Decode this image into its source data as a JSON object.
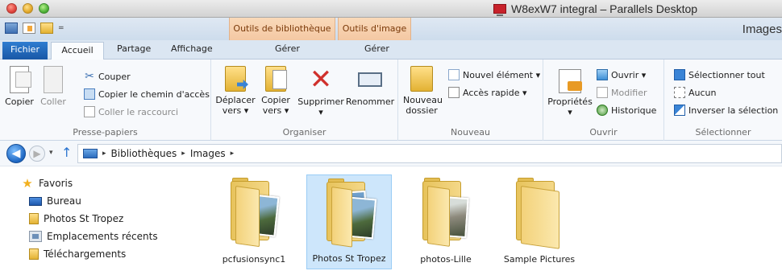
{
  "mac_window": {
    "title": "W8exW7 integral – Parallels Desktop"
  },
  "explorer_title": {
    "contextual_tabs": [
      "Outils de bibliothèque",
      "Outils d'image"
    ],
    "window_title": "Images"
  },
  "ribbon_tabs": {
    "file": "Fichier",
    "home": "Accueil",
    "share": "Partage",
    "view": "Affichage",
    "manage_library": "Gérer",
    "manage_image": "Gérer"
  },
  "ribbon": {
    "clipboard": {
      "label": "Presse-papiers",
      "copy": "Copier",
      "paste": "Coller",
      "cut": "Couper",
      "copy_path": "Copier le chemin d'accès",
      "paste_shortcut": "Coller le raccourci"
    },
    "organize": {
      "label": "Organiser",
      "move_to_1": "Déplacer",
      "move_to_2": "vers ▾",
      "copy_to_1": "Copier",
      "copy_to_2": "vers ▾",
      "delete": "Supprimer",
      "delete_arrow": "▾",
      "rename": "Renommer"
    },
    "new": {
      "label": "Nouveau",
      "new_folder_1": "Nouveau",
      "new_folder_2": "dossier",
      "new_item": "Nouvel élément ▾",
      "easy_access": "Accès rapide ▾"
    },
    "open": {
      "label": "Ouvrir",
      "properties": "Propriétés",
      "properties_arrow": "▾",
      "open": "Ouvrir ▾",
      "edit": "Modifier",
      "history": "Historique"
    },
    "select": {
      "label": "Sélectionner",
      "select_all": "Sélectionner tout",
      "select_none": "Aucun",
      "invert": "Inverser la sélection"
    }
  },
  "address_bar": {
    "back": "◀",
    "forward": "▶",
    "recent": "▾",
    "up": "↑",
    "separator": "▸",
    "crumbs": [
      "Bibliothèques",
      "Images"
    ]
  },
  "nav_pane": {
    "items": [
      {
        "label": "Favoris",
        "icon": "star-icon"
      },
      {
        "label": "Bureau",
        "icon": "desktop-icon"
      },
      {
        "label": "Photos St Tropez",
        "icon": "folder-icon"
      },
      {
        "label": "Emplacements récents",
        "icon": "recent-places-icon"
      },
      {
        "label": "Téléchargements",
        "icon": "folder-icon"
      }
    ]
  },
  "folders": [
    {
      "label": "pcfusionsync1",
      "selected": false
    },
    {
      "label": "Photos St Tropez",
      "selected": true
    },
    {
      "label": "photos-Lille",
      "selected": false
    },
    {
      "label": "Sample Pictures",
      "selected": false
    }
  ],
  "colors": {
    "file_tab": "#1957a6",
    "contextual_tab": "#f4c8a3",
    "selection": "#cde6fb"
  }
}
